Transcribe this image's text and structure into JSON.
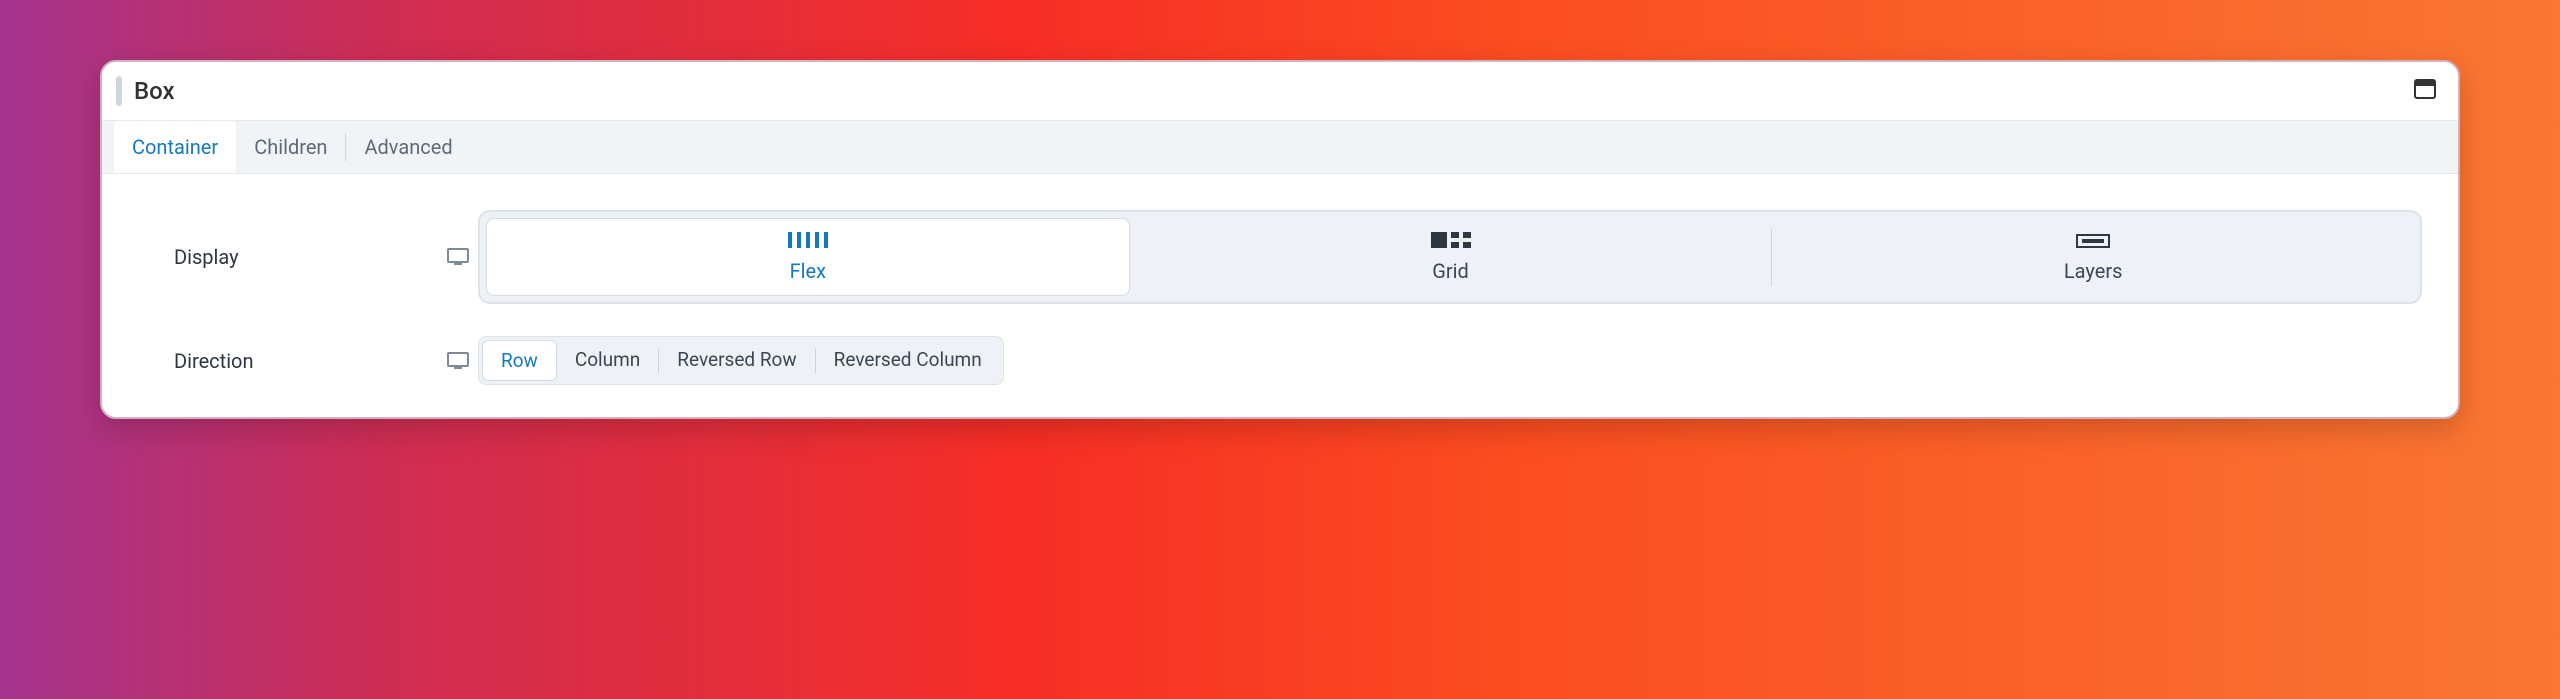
{
  "header": {
    "title": "Box"
  },
  "tabs": {
    "container": "Container",
    "children": "Children",
    "advanced": "Advanced"
  },
  "rows": {
    "display": {
      "label": "Display",
      "options": {
        "flex": "Flex",
        "grid": "Grid",
        "layers": "Layers"
      }
    },
    "direction": {
      "label": "Direction",
      "options": {
        "row": "Row",
        "column": "Column",
        "reversed_row": "Reversed Row",
        "reversed_column": "Reversed Column"
      }
    }
  }
}
